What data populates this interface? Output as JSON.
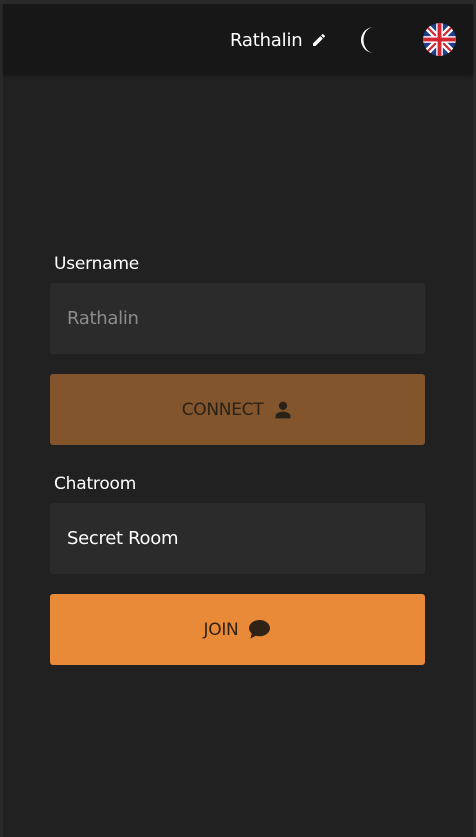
{
  "header": {
    "username": "Rathalin",
    "edit_icon": "pencil-icon",
    "theme_icon": "moon-icon",
    "language_icon": "uk-flag-icon"
  },
  "form": {
    "username_label": "Username",
    "username_placeholder": "Rathalin",
    "username_value": "",
    "connect_label": "CONNECT",
    "connect_icon": "user-icon",
    "chatroom_label": "Chatroom",
    "chatroom_value": "Secret Room",
    "join_label": "JOIN",
    "join_icon": "chat-bubble-icon"
  },
  "colors": {
    "background": "#212121",
    "topbar": "#171717",
    "input_bg": "#2b2b2b",
    "connect_disabled": "#82552c",
    "join_accent": "#e88a37"
  }
}
